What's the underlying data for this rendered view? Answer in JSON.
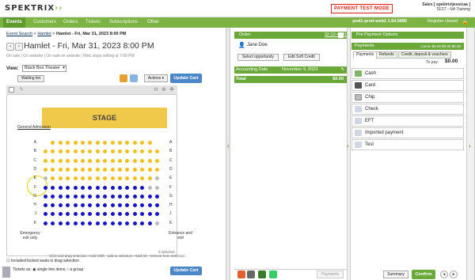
{
  "header": {
    "logo": "SPEKTRIX",
    "mode": "PAYMENT TEST MODE",
    "user_line1": "Sales [ spektrix\\jessicaa ]",
    "user_line2": "TEST - NA Training",
    "pod": "pod1-prod-web1  1.54.5895",
    "register": "Register closed"
  },
  "nav": [
    "Events",
    "Customers",
    "Orders",
    "Tickets",
    "Subscriptions",
    "Other"
  ],
  "event": {
    "breadcrumb": [
      "Event Search",
      "Hamlet",
      "Hamlet - Fri, Mar 31, 2023 8:00 PM"
    ],
    "title": "Hamlet - Fri, Mar 31, 2023 8:00 PM",
    "onsale": "On sale | On website | On sale on website | Web stops selling at 7:00 PM",
    "view_label": "View:",
    "view_value": "Black Box Theater",
    "waiting_list": "Waiting list",
    "actions": "Actions",
    "update_cart": "Update Cart"
  },
  "seatmap": {
    "stage": "STAGE",
    "general_admission": "General Admission",
    "rows": [
      "A",
      "B",
      "C",
      "D",
      "E",
      "F",
      "G",
      "H",
      "J",
      "K"
    ],
    "emergency": "Emergency exit only",
    "entrance": "Entrance and exit",
    "selected_text": "0 selected",
    "hint": "Click and drag selection. Hold Shift - add to selection. Hold Alt - remove from selection.",
    "include_locked": "Included locked seats in drag selection",
    "tickets_as": "Tickets as:",
    "opt_single": "single line items",
    "opt_group": "a group"
  },
  "order": {
    "label": "Order:",
    "number": "32-12-4181",
    "customer": "Jane Doe",
    "select_opportunity": "Select opportunity",
    "edit_soft_credit": "Edit Soft Credit",
    "accounting_label": "Accounting Date",
    "accounting_date": "November 9, 2023",
    "total_label": "Total",
    "total_value": "$0.00",
    "payments_btn": "Payments",
    "summary_btn": "Summary",
    "confirm_btn": "Confirm"
  },
  "payments": {
    "pre_payment": "Pre Payment Options",
    "header": "Payments",
    "header_vals": "Comm $0.00    $0.00    $0.00",
    "tabs": [
      "Payments",
      "Refunds",
      "Credit, deposit & vouchers"
    ],
    "to_pay_label": "To pay:",
    "to_pay_value": "$0.00",
    "methods": [
      "Cash",
      "Card",
      "Chip",
      "Check",
      "EFT",
      "Imported payment",
      "Test"
    ]
  }
}
